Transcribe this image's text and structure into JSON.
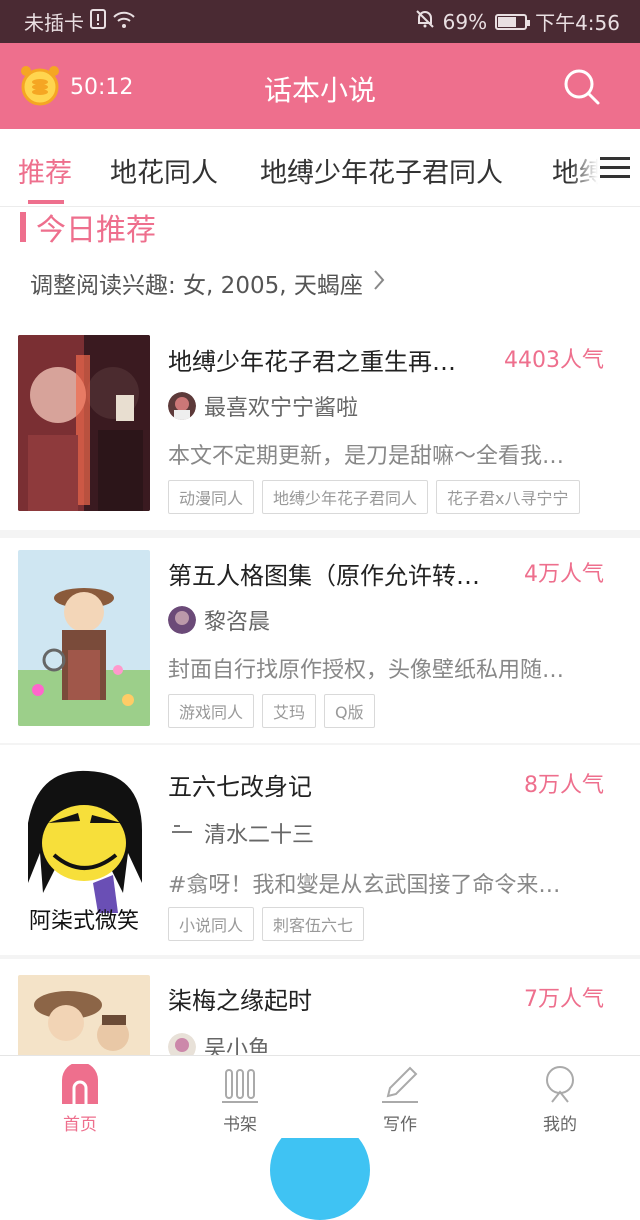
{
  "status_bar": {
    "carrier": "未插卡",
    "battery_percent": "69%",
    "battery_level": 0.69,
    "time": "下午4:56"
  },
  "app_bar": {
    "timer": "50:12",
    "title": "话本小说"
  },
  "tabs": [
    {
      "label": "推荐",
      "active": true
    },
    {
      "label": "地花同人",
      "active": false
    },
    {
      "label": "地缚少年花子君同人",
      "active": false
    },
    {
      "label": "地缚",
      "active": false
    }
  ],
  "section": {
    "title": "今日推荐",
    "interest": "调整阅读兴趣: 女, 2005, 天蝎座"
  },
  "books": [
    {
      "title": "地缚少年花子君之重生再…",
      "popularity": "4403人气",
      "author": "最喜欢宁宁酱啦",
      "description": "本文不定期更新，是刀是甜嘛～全看我…",
      "tags": [
        "动漫同人",
        "地缚少年花子君同人",
        "花子君x八寻宁宁"
      ]
    },
    {
      "title": "第五人格图集（原作允许转…",
      "popularity": "4万人气",
      "author": "黎咨晨",
      "description": "封面自行找原作授权，头像壁纸私用随…",
      "tags": [
        "游戏同人",
        "艾玛",
        "Q版"
      ]
    },
    {
      "title": "五六七改身记",
      "popularity": "8万人气",
      "author": "清水二十三",
      "description": "#翕呀！我和燮是从玄武国接了命令来…",
      "tags": [
        "小说同人",
        "刺客伍六七"
      ],
      "cover_text": "阿柒式微笑"
    },
    {
      "title": "柒梅之缘起时",
      "popularity": "7万人气",
      "author": "吴小鱼",
      "description": "",
      "tags": []
    }
  ],
  "bottom_nav": [
    {
      "label": "首页",
      "icon": "home-icon",
      "active": true
    },
    {
      "label": "书架",
      "icon": "bookshelf-icon",
      "active": false
    },
    {
      "label": "写作",
      "icon": "pen-icon",
      "active": false
    },
    {
      "label": "我的",
      "icon": "profile-icon",
      "active": false
    }
  ],
  "colors": {
    "accent": "#ee6f8d",
    "status_bar": "#4a2a33",
    "fab": "#3fc3f3"
  }
}
